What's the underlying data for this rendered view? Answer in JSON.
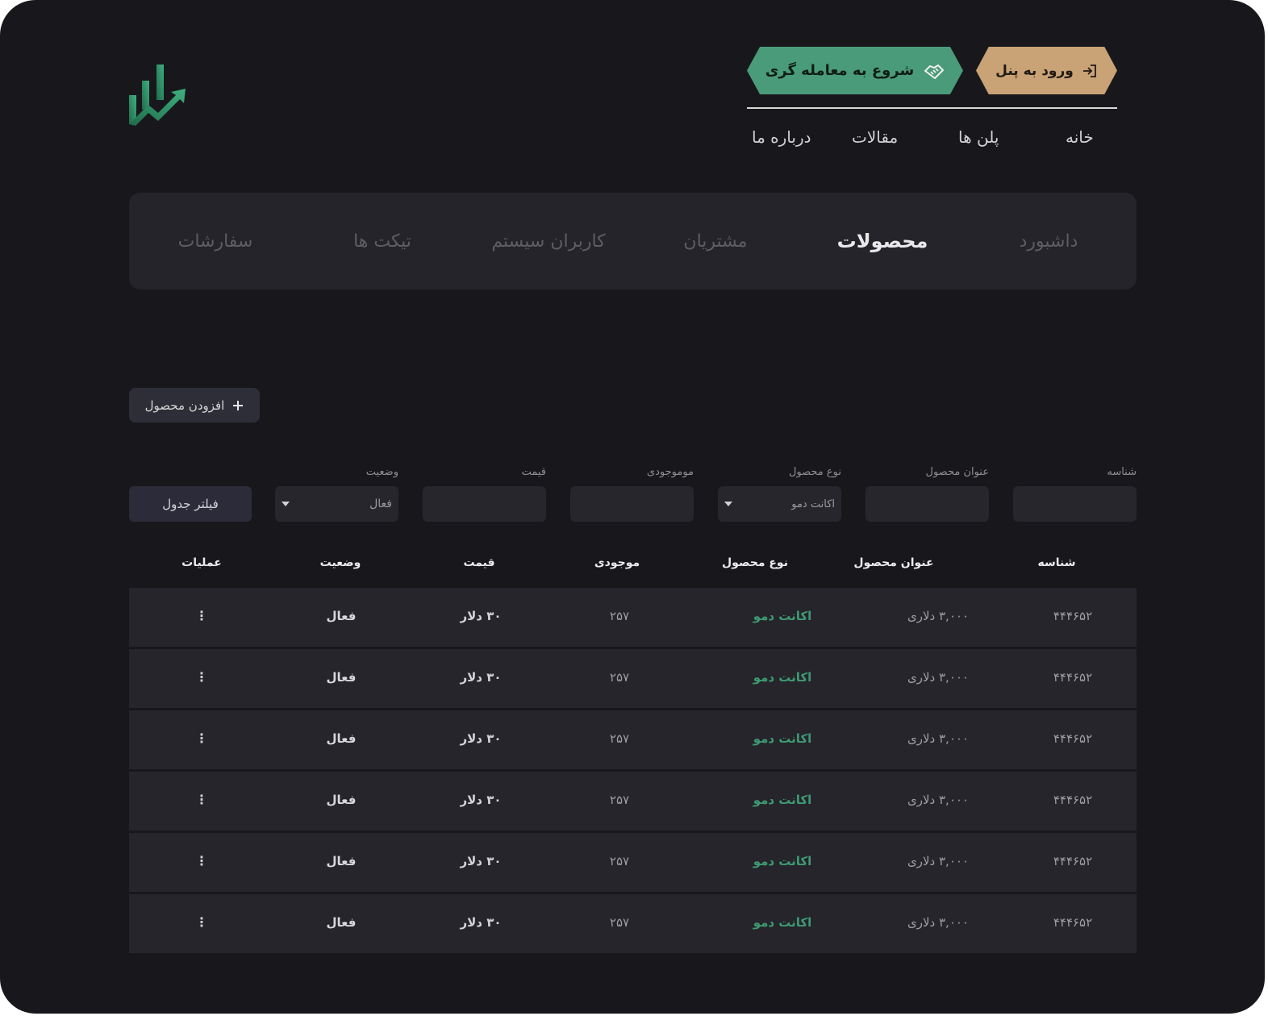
{
  "header": {
    "logo_icon": "chart-growth-logo-icon",
    "panel_button": {
      "label": "ورود به پنل",
      "icon": "login-icon"
    },
    "trade_button": {
      "label": "شروع به معامله گری",
      "icon": "handshake-icon"
    },
    "nav": [
      "خانه",
      "پلن ها",
      "مقالات",
      "درباره ما"
    ]
  },
  "tabs": {
    "items": [
      "داشبورد",
      "محصولات",
      "مشتریان",
      "کاربران سیستم",
      "تیکت ها",
      "سفارشات"
    ],
    "active": "محصولات"
  },
  "toolbar": {
    "add_product_label": "افزودن محصول",
    "add_icon": "plus-icon"
  },
  "filters": {
    "id": {
      "label": "شناسه",
      "value": ""
    },
    "title": {
      "label": "عنوان محصول",
      "value": ""
    },
    "type": {
      "label": "نوع محصول",
      "value": "اکانت دمو"
    },
    "stock": {
      "label": "موموجودی",
      "value": ""
    },
    "price": {
      "label": "قیمت",
      "value": ""
    },
    "status": {
      "label": "وضعیت",
      "value": "فعال"
    },
    "submit_label": "فیلتر جدول"
  },
  "table": {
    "headers": [
      "شناسه",
      "عنوان محصول",
      "نوع محصول",
      "موجودی",
      "قیمت",
      "وضعیت",
      "عملیات"
    ],
    "rows": [
      {
        "id": "۴۴۴۶۵۲",
        "title": "۳,۰۰۰ دلاری",
        "type": "اکانت دمو",
        "stock": "۲۵۷",
        "price": "۳۰ دلار",
        "status": "فعال",
        "ops": "⋮"
      },
      {
        "id": "۴۴۴۶۵۲",
        "title": "۳,۰۰۰ دلاری",
        "type": "اکانت دمو",
        "stock": "۲۵۷",
        "price": "۳۰ دلار",
        "status": "فعال",
        "ops": "⋮"
      },
      {
        "id": "۴۴۴۶۵۲",
        "title": "۳,۰۰۰ دلاری",
        "type": "اکانت دمو",
        "stock": "۲۵۷",
        "price": "۳۰ دلار",
        "status": "فعال",
        "ops": "⋮"
      },
      {
        "id": "۴۴۴۶۵۲",
        "title": "۳,۰۰۰ دلاری",
        "type": "اکانت دمو",
        "stock": "۲۵۷",
        "price": "۳۰ دلار",
        "status": "فعال",
        "ops": "⋮"
      },
      {
        "id": "۴۴۴۶۵۲",
        "title": "۳,۰۰۰ دلاری",
        "type": "اکانت دمو",
        "stock": "۲۵۷",
        "price": "۳۰ دلار",
        "status": "فعال",
        "ops": "⋮"
      },
      {
        "id": "۴۴۴۶۵۲",
        "title": "۳,۰۰۰ دلاری",
        "type": "اکانت دمو",
        "stock": "۲۵۷",
        "price": "۳۰ دلار",
        "status": "فعال",
        "ops": "⋮"
      }
    ]
  },
  "colors": {
    "background": "#18181c",
    "panel": "#24242a",
    "accent_green": "#4a9b79",
    "accent_gold": "#c9a276",
    "type_text": "#3f9a72"
  }
}
